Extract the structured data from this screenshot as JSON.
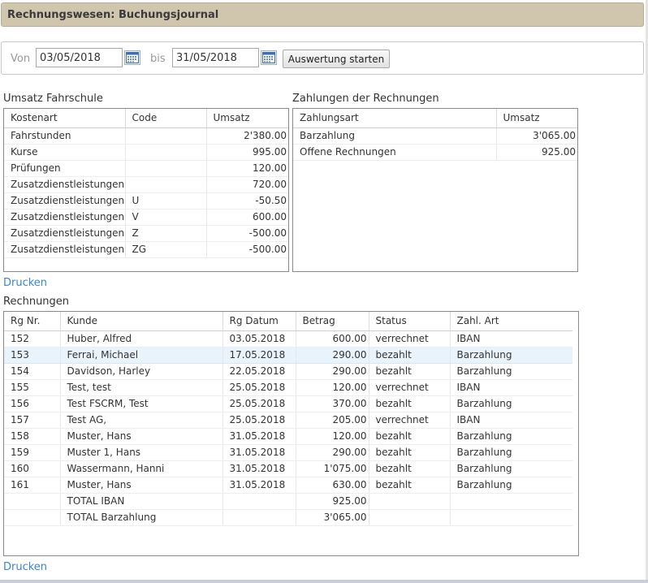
{
  "header": {
    "title": "Rechnungswesen: Buchungsjournal"
  },
  "filter": {
    "from_label": "Von",
    "from_value": "03/05/2018",
    "to_label": "bis",
    "to_value": "31/05/2018",
    "start_button": "Auswertung starten",
    "calendar_icon": "calendar-icon"
  },
  "umsatz": {
    "title": "Umsatz Fahrschule",
    "columns": [
      "Kostenart",
      "Code",
      "Umsatz"
    ],
    "rows": [
      [
        "Fahrstunden",
        "",
        "2'380.00"
      ],
      [
        "Kurse",
        "",
        "995.00"
      ],
      [
        "Prüfungen",
        "",
        "120.00"
      ],
      [
        "Zusatzdienstleistungen",
        "",
        "720.00"
      ],
      [
        "Zusatzdienstleistungen",
        "U",
        "-50.50"
      ],
      [
        "Zusatzdienstleistungen",
        "V",
        "600.00"
      ],
      [
        "Zusatzdienstleistungen",
        "Z",
        "-500.00"
      ],
      [
        "Zusatzdienstleistungen",
        "ZG",
        "-500.00"
      ]
    ]
  },
  "zahlungen": {
    "title": "Zahlungen der Rechnungen",
    "columns": [
      "Zahlungsart",
      "Umsatz"
    ],
    "rows": [
      [
        "Barzahlung",
        "3'065.00"
      ],
      [
        "Offene Rechnungen",
        "925.00"
      ]
    ]
  },
  "print_label": "Drucken",
  "rechnungen": {
    "title": "Rechnungen",
    "columns": [
      "Rg Nr.",
      "Kunde",
      "Rg Datum",
      "Betrag",
      "Status",
      "Zahl. Art"
    ],
    "rows": [
      [
        "152",
        "Huber, Alfred",
        "03.05.2018",
        "600.00",
        "verrechnet",
        "IBAN"
      ],
      [
        "153",
        "Ferrai, Michael",
        "17.05.2018",
        "290.00",
        "bezahlt",
        "Barzahlung"
      ],
      [
        "154",
        "Davidson, Harley",
        "22.05.2018",
        "290.00",
        "bezahlt",
        "Barzahlung"
      ],
      [
        "155",
        "Test, test",
        "25.05.2018",
        "120.00",
        "verrechnet",
        "IBAN"
      ],
      [
        "156",
        "Test FSCRM, Test",
        "25.05.2018",
        "370.00",
        "bezahlt",
        "Barzahlung"
      ],
      [
        "157",
        "Test AG,",
        "25.05.2018",
        "205.00",
        "verrechnet",
        "IBAN"
      ],
      [
        "158",
        "Muster, Hans",
        "31.05.2018",
        "120.00",
        "bezahlt",
        "Barzahlung"
      ],
      [
        "159",
        "Muster 1, Hans",
        "31.05.2018",
        "290.00",
        "bezahlt",
        "Barzahlung"
      ],
      [
        "160",
        "Wassermann, Hanni",
        "31.05.2018",
        "1'075.00",
        "bezahlt",
        "Barzahlung"
      ],
      [
        "161",
        "Muster, Hans",
        "31.05.2018",
        "630.00",
        "bezahlt",
        "Barzahlung"
      ],
      [
        "",
        "TOTAL IBAN",
        "",
        "925.00",
        "",
        ""
      ],
      [
        "",
        "TOTAL Barzahlung",
        "",
        "3'065.00",
        "",
        ""
      ]
    ],
    "highlighted_row": 1
  }
}
